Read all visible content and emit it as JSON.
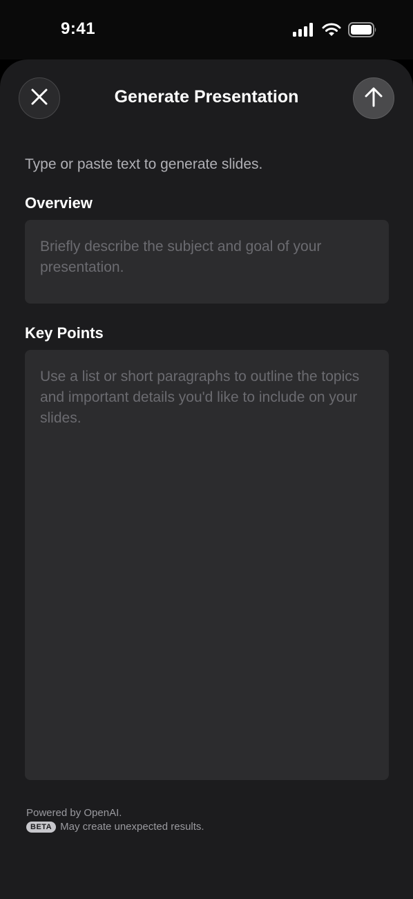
{
  "status_bar": {
    "time": "9:41",
    "icons": [
      "cellular-signal-icon",
      "wifi-icon",
      "battery-icon"
    ]
  },
  "header": {
    "title": "Generate Presentation",
    "close_icon": "close-icon",
    "send_icon": "arrow-up-icon"
  },
  "intro_text": "Type or paste text to generate slides.",
  "overview": {
    "label": "Overview",
    "placeholder": "Briefly describe the subject and goal of your presentation.",
    "value": ""
  },
  "key_points": {
    "label": "Key Points",
    "placeholder": "Use a list or short paragraphs to outline the topics and important details you'd like to include on your slides.",
    "value": ""
  },
  "footer": {
    "powered_by": "Powered by OpenAI.",
    "badge": "BETA",
    "disclaimer": "May create unexpected results."
  },
  "colors": {
    "sheet_background": "#1c1c1e",
    "field_background": "#2c2c2e",
    "placeholder_text": "#6b6b70"
  }
}
